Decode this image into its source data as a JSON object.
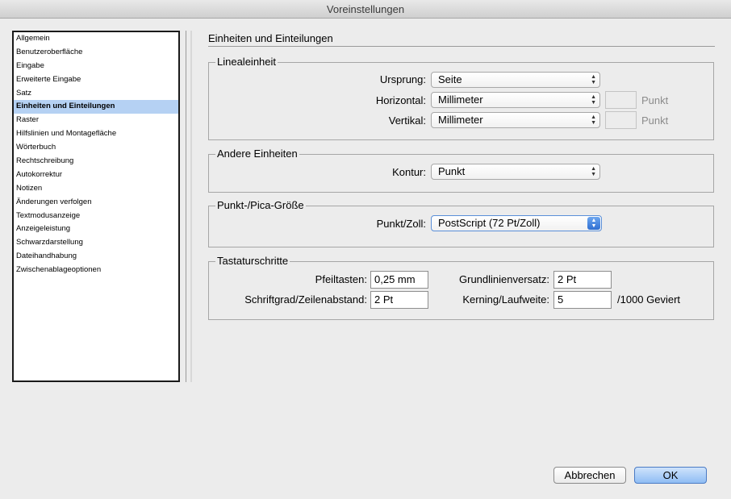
{
  "window": {
    "title": "Voreinstellungen"
  },
  "sidebar": {
    "items": [
      {
        "label": "Allgemein"
      },
      {
        "label": "Benutzeroberfläche"
      },
      {
        "label": "Eingabe"
      },
      {
        "label": "Erweiterte Eingabe"
      },
      {
        "label": "Satz"
      },
      {
        "label": "Einheiten und Einteilungen",
        "selected": true
      },
      {
        "label": "Raster"
      },
      {
        "label": "Hilfslinien und Montagefläche"
      },
      {
        "label": "Wörterbuch"
      },
      {
        "label": "Rechtschreibung"
      },
      {
        "label": "Autokorrektur"
      },
      {
        "label": "Notizen"
      },
      {
        "label": "Änderungen verfolgen"
      },
      {
        "label": "Textmodusanzeige"
      },
      {
        "label": "Anzeigeleistung"
      },
      {
        "label": "Schwarzdarstellung"
      },
      {
        "label": "Dateihandhabung"
      },
      {
        "label": "Zwischenablageoptionen"
      }
    ]
  },
  "page": {
    "title": "Einheiten und Einteilungen"
  },
  "lineal": {
    "legend": "Linealeinheit",
    "ursprung_label": "Ursprung:",
    "ursprung_value": "Seite",
    "horizontal_label": "Horizontal:",
    "horizontal_value": "Millimeter",
    "horizontal_points": "",
    "horizontal_unit": "Punkt",
    "vertikal_label": "Vertikal:",
    "vertikal_value": "Millimeter",
    "vertikal_points": "",
    "vertikal_unit": "Punkt"
  },
  "andere": {
    "legend": "Andere Einheiten",
    "kontur_label": "Kontur:",
    "kontur_value": "Punkt"
  },
  "pica": {
    "legend": "Punkt-/Pica-Größe",
    "punkt_zoll_label": "Punkt/Zoll:",
    "punkt_zoll_value": "PostScript (72 Pt/Zoll)"
  },
  "tastatur": {
    "legend": "Tastaturschritte",
    "pfeiltasten_label": "Pfeiltasten:",
    "pfeiltasten_value": "0,25 mm",
    "schriftgrad_label": "Schriftgrad/Zeilenabstand:",
    "schriftgrad_value": "2 Pt",
    "grundlinien_label": "Grundlinienversatz:",
    "grundlinien_value": "2 Pt",
    "kerning_label": "Kerning/Laufweite:",
    "kerning_value": "5",
    "kerning_unit": "/1000 Geviert"
  },
  "buttons": {
    "cancel": "Abbrechen",
    "ok": "OK"
  },
  "colors": {
    "selection": "#b5d1f3",
    "accent": "#2f6fd1"
  }
}
